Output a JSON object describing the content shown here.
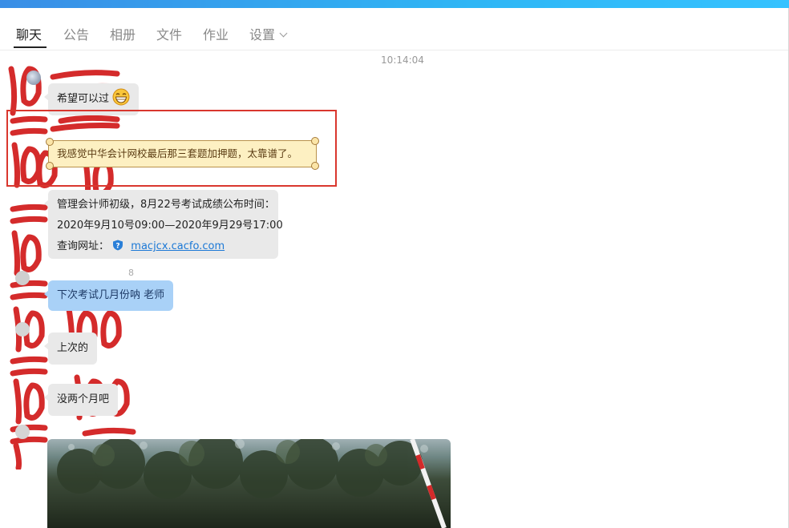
{
  "tabs": [
    {
      "label": "聊天",
      "active": true
    },
    {
      "label": "公告"
    },
    {
      "label": "相册"
    },
    {
      "label": "文件"
    },
    {
      "label": "作业"
    },
    {
      "label": "设置"
    }
  ],
  "timestamp": "10:14:04",
  "messages": {
    "m1": {
      "text": "希望可以过"
    },
    "m2": {
      "text": "我感觉中华会计网校最后那三套题加押题，太靠谱了。"
    },
    "m3": {
      "line1": "管理会计师初级，8月22号考试成绩公布时间：",
      "line2": "2020年9月10号09:00—2020年9月29号17:00",
      "line3_label": "查询网址：",
      "link": "macjcx.cacfo.com"
    },
    "m4_meta": "8",
    "m4": {
      "text": "下次考试几月份呐 老师"
    },
    "m5": {
      "text": "上次的"
    },
    "m6": {
      "text": "没两个月吧"
    }
  },
  "colors": {
    "accent_top": "#2fb6f5",
    "highlight_border": "#d9372e",
    "self_bubble": "#a9d1f7",
    "other_bubble": "#e9e9e9",
    "link": "#1b78d6"
  },
  "icons": {
    "settings_dropdown": "chevron-down-icon",
    "link_icon": "shield-question-icon",
    "emoji": "grin-emoji-icon"
  }
}
